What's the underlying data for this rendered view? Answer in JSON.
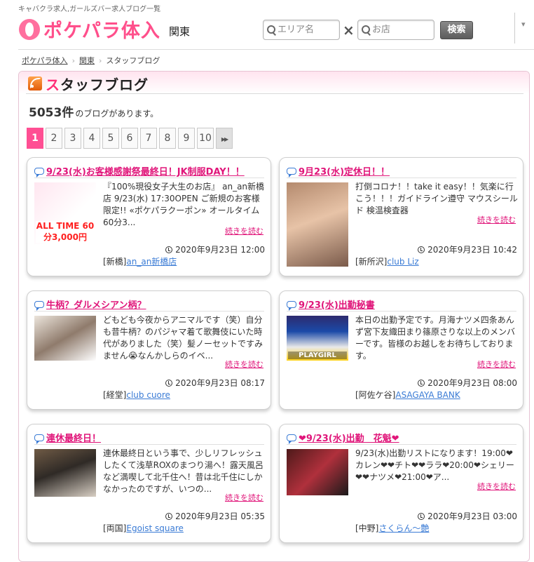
{
  "header": {
    "tagline": "キャバクラ求人,ガールズバー求人ブログ一覧",
    "logo": "ポケパラ体入",
    "region": "関東",
    "area_placeholder": "エリア名",
    "shop_placeholder": "お店",
    "search_label": "検索"
  },
  "breadcrumb": [
    "ポケパラ体入",
    "関東",
    "スタッフブログ"
  ],
  "panel": {
    "title_first": "ス",
    "title_rest": "タッフブログ",
    "count_num": "5053件",
    "count_text": "のブログがあります。"
  },
  "pager": [
    "1",
    "2",
    "3",
    "4",
    "5",
    "6",
    "7",
    "8",
    "9",
    "10"
  ],
  "more_label": "続きを読む",
  "cards": [
    {
      "title": "9/23(水)お客様感謝祭最終日！JK制服DAY！！",
      "excerpt": "『100%現役女子大生のお店』 an_an新橋店 9/23(水) 17:30OPEN ご新規のお客様限定!! «ポケパラクーポン» オールタイム60分3...",
      "date": "2020年9月23日 12:00",
      "area": "[新橋]",
      "shop": "an_an新橋店",
      "thumb_text": "ALL TIME 60分3,000円"
    },
    {
      "title": "9月23(水)定休日！！",
      "excerpt": "打倒コロナ！！take it easy！！気楽に行こう！！！ガイドライン遵守 マウスシールド 検温検査器",
      "date": "2020年9月23日 10:42",
      "area": "[新所沢]",
      "shop": "club Liz",
      "thumb_text": ""
    },
    {
      "title": "牛柄？ダルメシアン柄？",
      "excerpt": "どもども今夜からアニマルです（笑）自分も昔牛柄？のパジャマ着て歌舞伎にいた時代がありました（笑）髪ノーセットですみません😭なんかしらのイベ...",
      "date": "2020年9月23日 08:17",
      "area": "[経堂]",
      "shop": "club cuore",
      "thumb_text": ""
    },
    {
      "title": "9/23(水)出勤秘書",
      "excerpt": "本日の出勤予定です。月海ナツメ四条あんず宮下友織田まり篠原さりな以上のメンバーです。皆様のお越しをお待ちしております。",
      "date": "2020年9月23日 08:00",
      "area": "[阿佐ケ谷]",
      "shop": "ASAGAYA BANK",
      "thumb_text": "PLAYGIRL"
    },
    {
      "title": "連休最終日！",
      "excerpt": "連休最終日という事で、少しリフレッシュしたくて浅草ROXのまつり湯へ！露天風呂など満喫して北千住へ！昔は北千住にしかなかったのですが、いつの...",
      "date": "2020年9月23日 05:35",
      "area": "[両国]",
      "shop": "Egoist square",
      "thumb_text": ""
    },
    {
      "title": "❤9/23(水)出勤　花魁❤",
      "excerpt": "9/23(水)出勤リストになります！19:00❤カレン❤❤チト❤❤ララ❤20:00❤シェリー❤❤ナツメ❤21:00❤ア...",
      "date": "2020年9月23日 03:00",
      "area": "[中野]",
      "shop": "さくらん〜艶",
      "thumb_text": ""
    }
  ]
}
